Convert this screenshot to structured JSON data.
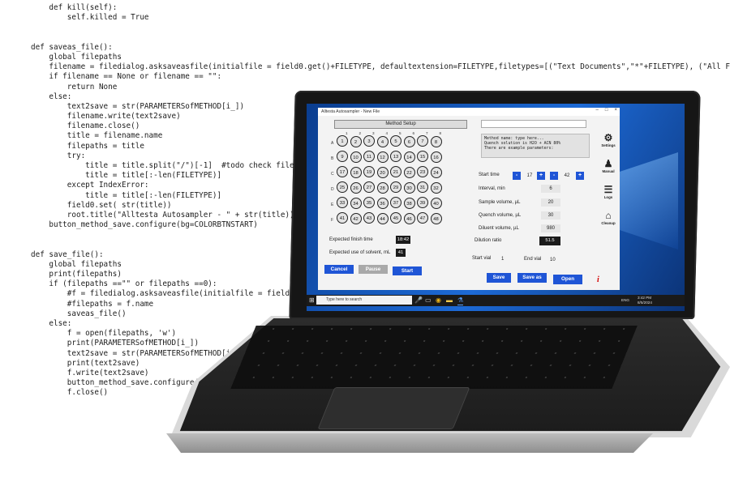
{
  "code_lines": [
    "    def kill(self):",
    "        self.killed = True",
    "",
    "",
    "def saveas_file():",
    "    global filepaths",
    "    filename = filedialog.asksaveasfile(initialfile = field0.get()+FILETYPE, defaultextension=FILETYPE,filetypes=[(\"Text Documents\",\"*\"+FILETYPE), (\"All Files\",",
    "    if filename == None or filename == \"\":",
    "        return None",
    "    else:",
    "        text2save = str(PARAMETERSofMETHOD[i_])",
    "        filename.write(text2save)",
    "        filename.close()",
    "        title = filename.name",
    "        filepaths = title",
    "        try:",
    "            title = title.split(\"/\")[-1]  #todo check file extens",
    "            title = title[:-len(FILETYPE)]",
    "        except IndexError:",
    "            title = title[:-len(FILETYPE)]",
    "        field0.set( str(title))",
    "        root.title(\"Alltesta Autosampler - \" + str(title))",
    "    button_method_save.configure(bg=COLORBTNSTART)",
    "",
    "",
    "def save_file():",
    "    global filepaths",
    "    print(filepaths)",
    "    if (filepaths ==\"\" or filepaths ==0):",
    "        #f = filedialog.asksaveasfile(initialfile = field0.get",
    "        #filepaths = f.name",
    "        saveas_file()",
    "    else:",
    "        f = open(filepaths, 'w')",
    "        print(PARAMETERSofMETHOD[i_])",
    "        text2save = str(PARAMETERSofMETHOD[i_])",
    "        print(text2save)",
    "        f.write(text2save)",
    "        button_method_save.configure(bg=",
    "        f.close()"
  ],
  "app": {
    "window_title": "Alltesta Autosampler - New File",
    "window_buttons": [
      "–",
      "□",
      "×"
    ],
    "method_setup_label": "Method Setup",
    "row_letters": [
      "A",
      "B",
      "C",
      "D",
      "E",
      "F"
    ],
    "column_numbers": [
      "1",
      "2",
      "3",
      "4",
      "5",
      "6",
      "7",
      "8"
    ],
    "wells": [
      [
        "1",
        "2",
        "3",
        "4",
        "5",
        "6",
        "7",
        "8"
      ],
      [
        "9",
        "10",
        "11",
        "12",
        "13",
        "14",
        "15",
        "16"
      ],
      [
        "17",
        "18",
        "19",
        "20",
        "21",
        "22",
        "23",
        "24"
      ],
      [
        "25",
        "26",
        "27",
        "28",
        "29",
        "30",
        "31",
        "32"
      ],
      [
        "33",
        "34",
        "35",
        "36",
        "37",
        "38",
        "39",
        "40"
      ],
      [
        "41",
        "42",
        "43",
        "44",
        "45",
        "46",
        "47",
        "48"
      ]
    ],
    "finish_time_label": "Expected finish time",
    "finish_time_value": "18:42",
    "solvent_label": "Expected use of solvent, mL",
    "solvent_value": "41",
    "cancel_label": "Cancel",
    "pause_label": "Pause",
    "start_label": "Start",
    "method_name_text": "Method name: type here...\nQuench solution is H2O + ACN 80%\nThere are example parameters:",
    "start_time_label": "Start time",
    "start_hour": "17",
    "start_minute": "42",
    "minus": "-",
    "plus": "+",
    "interval_label": "Interval, min",
    "interval_value": "6",
    "sample_volume_label": "Sample volume, µL",
    "sample_volume_value": "20",
    "quench_volume_label": "Quench volume, µL",
    "quench_volume_value": "30",
    "diluent_volume_label": "Diluent volume, µL",
    "diluent_volume_value": "980",
    "dilution_ratio_label": "Dilution ratio",
    "dilution_ratio_value": "51.5",
    "start_vial_label": "Start vial",
    "start_vial_value": "1",
    "end_vial_label": "End vial",
    "end_vial_value": "10",
    "save_label": "Save",
    "save_as_label": "Save as",
    "open_label": "Open",
    "info_glyph": "i",
    "sidebar": [
      {
        "label": "Settings",
        "icon": "⚙"
      },
      {
        "label": "Manual",
        "icon": "♟"
      },
      {
        "label": "Logs",
        "icon": "☰"
      },
      {
        "label": "Cleanup",
        "icon": "⌂"
      }
    ]
  },
  "taskbar": {
    "search_placeholder": "Type here to search",
    "tray_time": "3:42 PM",
    "tray_date": "8/5/2024",
    "tray_lang": "ENG"
  },
  "colors": {
    "accent_blue": "#1f55d6",
    "disabled_grey": "#a9a9a9",
    "info_red": "#d40000"
  }
}
